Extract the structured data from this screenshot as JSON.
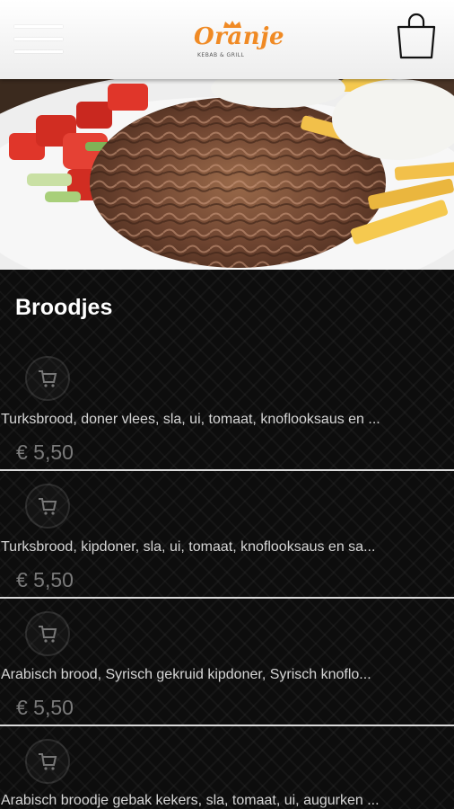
{
  "header": {
    "logo_text": "Oranje",
    "logo_sub": "KEBAB & GRILL"
  },
  "section": {
    "title": "Broodjes"
  },
  "items": [
    {
      "description": "Turksbrood, doner vlees, sla, ui, tomaat, knoflooksaus en ...",
      "price": "€ 5,50"
    },
    {
      "description": "Turksbrood, kipdoner, sla, ui, tomaat, knoflooksaus en sa...",
      "price": "€ 5,50"
    },
    {
      "description": "Arabisch brood, Syrisch gekruid kipdoner, Syrisch knoflo...",
      "price": "€ 5,50"
    },
    {
      "description": "Arabisch broodje gebak kekers, sla, tomaat, ui, augurken ...",
      "price": ""
    }
  ],
  "colors": {
    "accent": "#f08a24",
    "background": "#0d0d0d",
    "divider": "#d9d9d9"
  },
  "icons": {
    "menu": "hamburger-icon",
    "cart": "shopping-bag-icon",
    "item": "cart-icon"
  }
}
